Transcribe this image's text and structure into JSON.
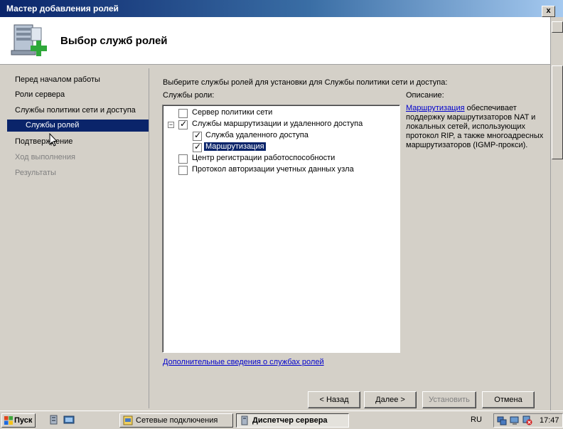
{
  "window": {
    "title": "Мастер добавления ролей",
    "close_label": "x"
  },
  "header": {
    "title": "Выбор служб ролей"
  },
  "nav": {
    "items": [
      {
        "label": "Перед началом работы",
        "state": "normal"
      },
      {
        "label": "Роли сервера",
        "state": "normal"
      },
      {
        "label": "Службы политики сети и доступа",
        "state": "normal"
      },
      {
        "label": "Службы ролей",
        "state": "selected"
      },
      {
        "label": "Подтверждение",
        "state": "normal"
      },
      {
        "label": "Ход выполнения",
        "state": "disabled"
      },
      {
        "label": "Результаты",
        "state": "disabled"
      }
    ]
  },
  "main": {
    "instruction": "Выберите службы ролей для установки для Службы политики сети и доступа:",
    "roles_label": "Службы роли:",
    "description_label": "Описание:",
    "tree": [
      {
        "label": "Сервер политики сети",
        "checked": false
      },
      {
        "label": "Службы маршрутизации и удаленного доступа",
        "checked": true,
        "expander": "−"
      },
      {
        "label": "Служба удаленного доступа",
        "checked": true
      },
      {
        "label": "Маршрутизация",
        "checked": true,
        "selected": true
      },
      {
        "label": "Центр регистрации работоспособности",
        "checked": false
      },
      {
        "label": "Протокол авторизации учетных данных узла",
        "checked": false
      }
    ],
    "description": {
      "link": "Маршрутизация",
      "text": " обеспечивает поддержку маршрутизаторов NAT и локальных сетей, использующих протокол RIP, а также многоадресных маршрутизаторов (IGMP-прокси)."
    },
    "more_link": "Дополнительные сведения о службах ролей"
  },
  "buttons": {
    "back": "< Назад",
    "next": "Далее >",
    "install": "Установить",
    "cancel": "Отмена"
  },
  "taskbar": {
    "start": "Пуск",
    "tasks": [
      {
        "label": "Сетевые подключения",
        "active": false
      },
      {
        "label": "Диспетчер сервера",
        "active": true
      }
    ],
    "language": "RU",
    "clock": "17:47"
  },
  "colors": {
    "selection": "#0a246a",
    "link": "#0000cc",
    "titlebar": "#0a246a"
  }
}
